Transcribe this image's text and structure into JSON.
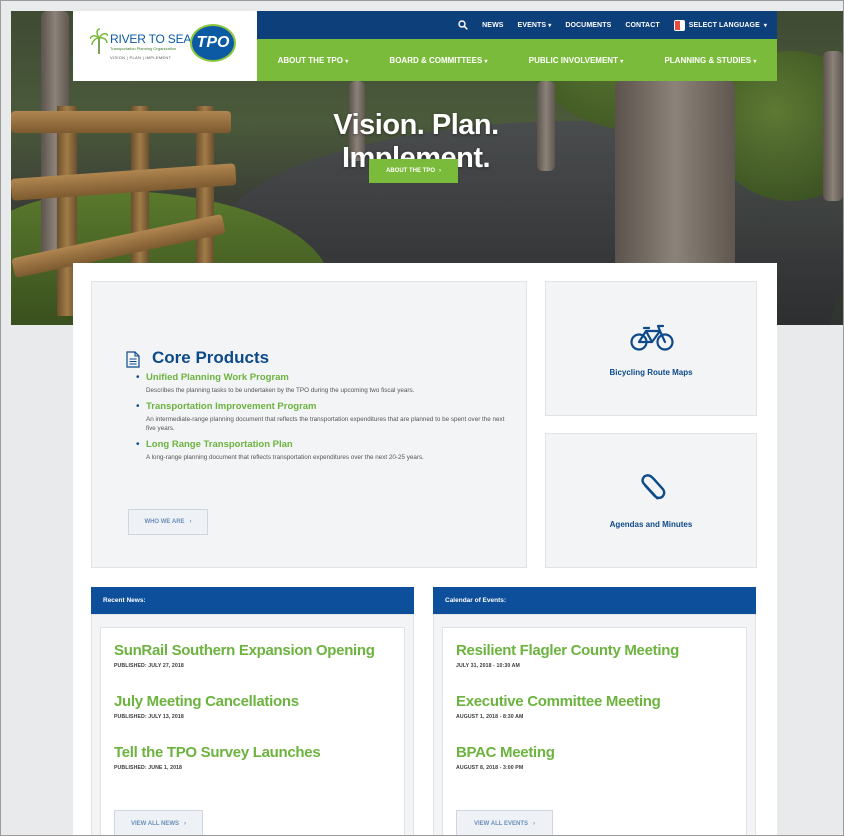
{
  "logo": {
    "brand": "RIVER TO SEA",
    "mark": "TPO",
    "tagline": "Transportation Planning Organization",
    "motto": "VISION | PLAN | IMPLEMENT"
  },
  "utility_nav": {
    "news": "NEWS",
    "events": "EVENTS",
    "documents": "DOCUMENTS",
    "contact": "CONTACT",
    "language": "SELECT LANGUAGE"
  },
  "main_nav": {
    "items": [
      "ABOUT THE TPO",
      "BOARD & COMMITTEES",
      "PUBLIC INVOLVEMENT",
      "PLANNING & STUDIES"
    ]
  },
  "hero": {
    "title": "Vision. Plan. Implement.",
    "button": "ABOUT THE TPO"
  },
  "core": {
    "title": "Core Products",
    "items": [
      {
        "title": "Unified Planning Work Program",
        "desc": "Describes the planning tasks to be undertaken by the TPO during the upcoming two fiscal years."
      },
      {
        "title": "Transportation Improvement Program",
        "desc": "An intermediate-range planning document that reflects the transportation expenditures that are planned to be spent over the next five years."
      },
      {
        "title": "Long Range Transportation Plan",
        "desc": "A long-range planning document that reflects transportation expenditures over the next 20-25 years."
      }
    ],
    "button": "WHO WE ARE"
  },
  "side": {
    "bike_label": "Bicycling Route Maps",
    "agenda_label": "Agendas and Minutes"
  },
  "news": {
    "heading": "Recent News:",
    "items": [
      {
        "title": "SunRail Southern Expansion Opening",
        "meta": "PUBLISHED: JULY 27, 2018"
      },
      {
        "title": "July Meeting Cancellations",
        "meta": "PUBLISHED: JULY 13, 2018"
      },
      {
        "title": "Tell the TPO Survey Launches",
        "meta": "PUBLISHED: JUNE 1, 2018"
      }
    ],
    "button": "VIEW ALL NEWS"
  },
  "events": {
    "heading": "Calendar of Events:",
    "items": [
      {
        "title": "Resilient Flagler County Meeting",
        "meta": "JULY 31, 2018 - 10:30 AM"
      },
      {
        "title": "Executive Committee Meeting",
        "meta": "AUGUST 1, 2018 - 8:30 AM"
      },
      {
        "title": "BPAC Meeting",
        "meta": "AUGUST 8, 2018 - 3:00 PM"
      }
    ],
    "button": "VIEW ALL EVENTS"
  },
  "colors": {
    "brand_blue": "#0d4f9a",
    "nav_green": "#7bbb3b",
    "link_green": "#6cb33f"
  }
}
